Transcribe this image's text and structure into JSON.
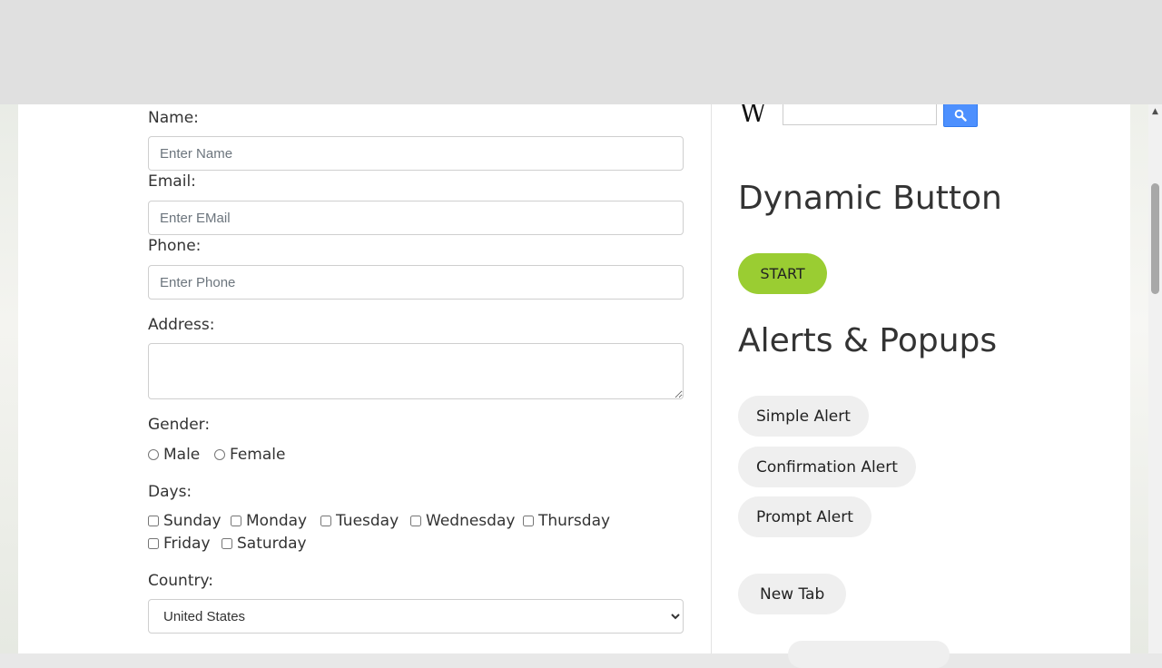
{
  "form": {
    "name": {
      "label": "Name:",
      "placeholder": "Enter Name"
    },
    "email": {
      "label": "Email:",
      "placeholder": "Enter EMail"
    },
    "phone": {
      "label": "Phone:",
      "placeholder": "Enter Phone"
    },
    "address": {
      "label": "Address:"
    },
    "gender": {
      "label": "Gender:",
      "options": [
        "Male",
        "Female"
      ]
    },
    "days": {
      "label": "Days:",
      "options": [
        "Sunday",
        "Monday",
        "Tuesday",
        "Wednesday",
        "Thursday",
        "Friday",
        "Saturday"
      ]
    },
    "country": {
      "label": "Country:",
      "selected": "United States"
    }
  },
  "sidebar": {
    "wiki_logo": "W",
    "dynamic_button": {
      "title": "Dynamic Button",
      "start_label": "START"
    },
    "alerts": {
      "title": "Alerts & Popups",
      "simple": "Simple Alert",
      "confirmation": "Confirmation Alert",
      "prompt": "Prompt Alert"
    },
    "new_tab": "New Tab"
  },
  "colors": {
    "start_button": "#9acd32",
    "pill_button": "#efefef",
    "search_button": "#4d90fe"
  }
}
